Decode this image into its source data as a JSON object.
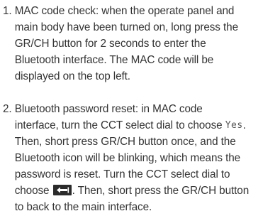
{
  "doc": {
    "items": [
      {
        "num": "1. ",
        "lines": [
          "MAC code check: when the operate panel and",
          "main body have been turned on, long press the",
          "GR/CH button for 2 seconds to enter the",
          "Bluetooth interface. The MAC code will be",
          "displayed on the top left."
        ]
      },
      {
        "num": "2. ",
        "l1": "Bluetooth password reset: in MAC code",
        "l2_pre": "interface, turn the CCT select dial to choose ",
        "l2_lcd": "Yes",
        "l2_post": ".",
        "l3": "Then, short press GR/CH button once, and the",
        "l4": "Bluetooth icon will be blinking, which means the",
        "l5": "password is reset. Turn the CCT select dial to",
        "l6_pre": "choose ",
        "back_icon": "back-arrow-icon",
        "l6_post": ". Then, short press the GR/CH button",
        "l7": "to back to the main interface."
      }
    ]
  }
}
